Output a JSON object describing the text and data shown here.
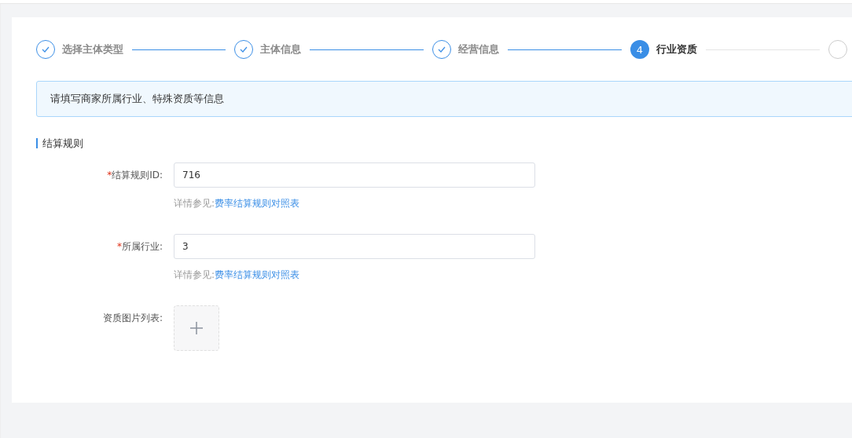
{
  "steps": [
    {
      "label": "选择主体类型",
      "completed": true,
      "current": false
    },
    {
      "label": "主体信息",
      "completed": true,
      "current": false
    },
    {
      "label": "经营信息",
      "completed": true,
      "current": false
    },
    {
      "number": "4",
      "label": "行业资质",
      "completed": false,
      "current": true
    },
    {
      "completed": false,
      "current": false
    }
  ],
  "alert": "请填写商家所属行业、特殊资质等信息",
  "section_title": "结算规则",
  "fields": [
    {
      "kind": "input",
      "required_mark": "*",
      "label": "结算规则ID:",
      "value": "716",
      "hint": "详情参见:",
      "link": "费率结算规则对照表"
    },
    {
      "kind": "input",
      "required_mark": "*",
      "label": "所属行业:",
      "value": "3",
      "hint": "详情参见:",
      "link": "费率结算规则对照表"
    },
    {
      "kind": "upload",
      "label": "资质图片列表:"
    }
  ]
}
